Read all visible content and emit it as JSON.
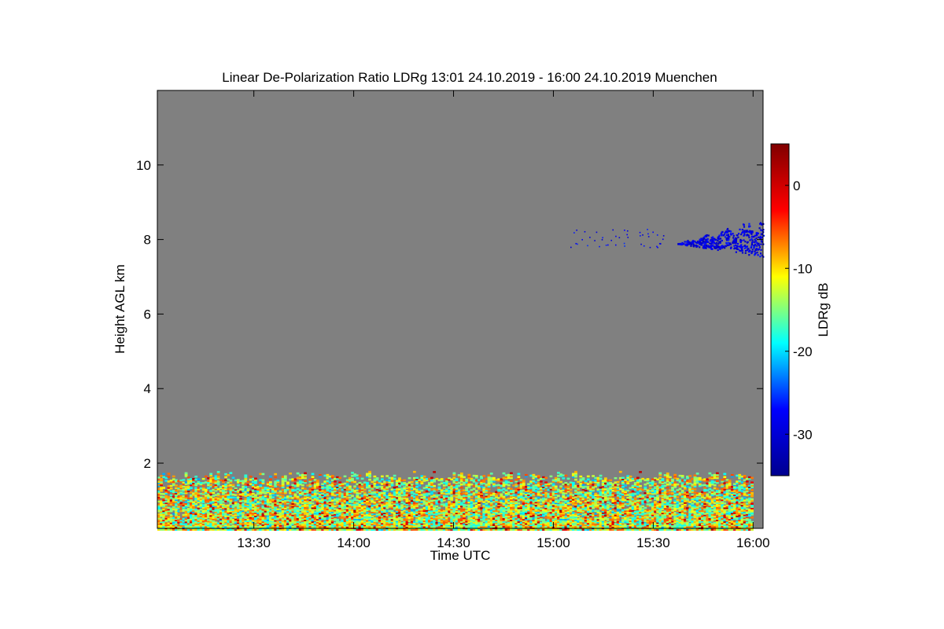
{
  "chart_data": {
    "type": "heatmap",
    "title": "Linear De-Polarization Ratio LDRg   13:01 24.10.2019 - 16:00 24.10.2019 Muenchen",
    "xlabel": "Time UTC",
    "ylabel": "Height AGL km",
    "colorbar_label": "LDRg dB",
    "x_range": [
      "13:01",
      "16:03"
    ],
    "x_ticks": [
      "13:30",
      "14:00",
      "14:30",
      "15:00",
      "15:30",
      "16:00"
    ],
    "y_range_km": [
      0.25,
      12.0
    ],
    "y_ticks": [
      2,
      4,
      6,
      8,
      10
    ],
    "colorbar_range_db": [
      -35,
      5
    ],
    "colorbar_ticks": [
      0,
      -10,
      -20,
      -30
    ],
    "colormap": [
      "#00008f",
      "#0000ff",
      "#00ffff",
      "#ffff00",
      "#ff0000",
      "#800000"
    ],
    "background_no_data_color": "#808080",
    "features": [
      {
        "description": "boundary layer depolarization",
        "time_range": [
          "13:01",
          "16:00"
        ],
        "height_km": [
          0.2,
          1.8
        ],
        "ldr_db_range": [
          -22,
          2
        ],
        "typical_ldr_db": -12
      },
      {
        "description": "ice cloud",
        "time_range": [
          "15:37",
          "16:03"
        ],
        "height_km": [
          7.55,
          9.2
        ],
        "typical_ldr_db": -29
      },
      {
        "description": "isolated cloud patches",
        "time_range": [
          "15:05",
          "15:35"
        ],
        "height_km": [
          7.8,
          8.3
        ],
        "typical_ldr_db": -28
      }
    ]
  }
}
